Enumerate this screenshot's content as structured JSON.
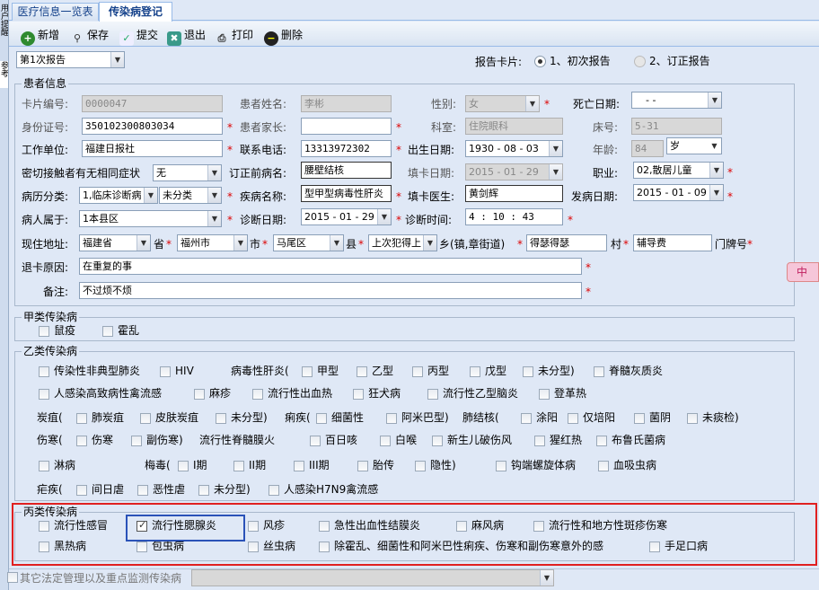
{
  "tabs": [
    {
      "label": "医疗信息一览表"
    },
    {
      "label": "传染病登记"
    }
  ],
  "side": {
    "text1": "用户提醒",
    "text2": "参考"
  },
  "toolbar": {
    "new": "新增",
    "save": "保存",
    "submit": "提交",
    "exit": "退出",
    "print": "打印",
    "delete": "删除"
  },
  "report_select": "第1次报告",
  "card": {
    "label": "报告卡片:",
    "opt1": "1、初次报告",
    "opt2": "2、订正报告",
    "selected": "1、初次报告"
  },
  "patient": {
    "section": "患者信息",
    "card_no_label": "卡片编号:",
    "card_no": "0000047",
    "name_label": "患者姓名:",
    "name": "李彬",
    "sex_label": "性别:",
    "sex": "女",
    "death_label": "死亡日期:",
    "death": "-  -",
    "id_label": "身份证号:",
    "id": "350102300803034",
    "parent_label": "患者家长:",
    "parent": "",
    "dept_label": "科室:",
    "dept": "住院眼科",
    "bed_label": "床号:",
    "bed": "5-31",
    "work_label": "工作单位:",
    "work": "福建日报社",
    "phone_label": "联系电话:",
    "phone": "13313972302",
    "birth_label": "出生日期:",
    "birth": "1930 - 08 - 03",
    "age_label": "年龄:",
    "age": "84",
    "age_unit": "岁",
    "contact_label": "密切接触者有无相同症状",
    "contact": "无",
    "orig_dx_label": "订正前病名:",
    "orig_dx": "腰壁结核",
    "fill_date_label": "填卡日期:",
    "fill_date": "2015 - 01 - 29",
    "job_label": "职业:",
    "job": "02,散居儿童",
    "case_class_label": "病历分类:",
    "case_class1": "1,临床诊断病",
    "case_class2": "未分类",
    "disease_label": "疾病名称:",
    "disease": "型甲型病毒性肝炎",
    "doctor_label": "填卡医生:",
    "doctor": "黄剑辉",
    "onset_label": "发病日期:",
    "onset": "2015 - 01 - 09",
    "belong_label": "病人属于:",
    "belong": "1本县区",
    "dx_date_label": "诊断日期:",
    "dx_date": "2015 - 01 - 29",
    "dx_time_label": "诊断时间:",
    "dx_time": "4 : 10 : 43",
    "addr_label": "现住地址:",
    "province": "福建省",
    "province_unit": "省",
    "city": "福州市",
    "city_unit": "市",
    "district": "马尾区",
    "district_unit": "县",
    "town": "上次犯得上",
    "town_unit": "乡(镇,章街道)",
    "village": "得瑟得瑟",
    "village_unit": "村",
    "house": "辅导费",
    "house_unit": "门牌号",
    "return_label": "退卡原因:",
    "return": "在重复的事",
    "note_label": "备注:",
    "note": "不过烦不烦"
  },
  "classA": {
    "title": "甲类传染病",
    "items": [
      "鼠疫",
      "霍乱"
    ]
  },
  "classB": {
    "title": "乙类传染病",
    "r1": [
      "传染性非典型肺炎",
      "HIV",
      "病毒性肝炎(",
      "甲型",
      "乙型",
      "丙型",
      "戊型",
      "未分型)",
      "脊髓灰质炎"
    ],
    "r2": [
      "人感染高致病性禽流感",
      "麻疹",
      "流行性出血热",
      "狂犬病",
      "流行性乙型脑炎",
      "登革热"
    ],
    "r3": [
      "炭疽(",
      "肺炭疽",
      "皮肤炭疽",
      "未分型)",
      "痢疾(",
      "细菌性",
      "阿米巴型)",
      "肺结核(",
      "涂阳",
      "仅培阳",
      "菌阴",
      "未痰检)"
    ],
    "r4": [
      "伤寒(",
      "伤寒",
      "副伤寒)",
      "流行性脊髓膜火",
      "百日咳",
      "白喉",
      "新生儿破伤风",
      "猩红热",
      "布鲁氏菌病"
    ],
    "r5": [
      "淋病",
      "梅毒(",
      "I期",
      "II期",
      "III期",
      "胎传",
      "隐性)",
      "钩端螺旋体病",
      "血吸虫病"
    ],
    "r6": [
      "疟疾(",
      "间日虐",
      "恶性虐",
      "未分型)",
      "人感染H7N9禽流感"
    ]
  },
  "classC": {
    "title": "丙类传染病",
    "r1": [
      "流行性感冒",
      "流行性腮腺炎",
      "风疹",
      "急性出血性结膜炎",
      "麻风病",
      "流行性和地方性斑疹伤寒"
    ],
    "r2": [
      "黑热病",
      "包虫病",
      "丝虫病",
      "除霍乱、细菌性和阿米巴性痢疾、伤寒和副伤寒意外的感",
      "手足口病"
    ],
    "checked": "流行性腮腺炎"
  },
  "other": {
    "label": "其它法定管理以及重点监测传染病"
  },
  "side_tab": "中"
}
